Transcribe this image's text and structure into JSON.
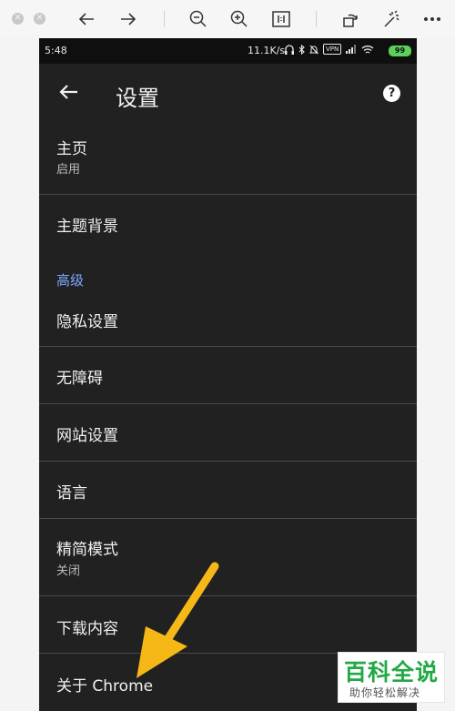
{
  "viewer": {
    "tools": [
      "close-dot",
      "minimize-dot",
      "back-arrow-icon",
      "forward-arrow-icon",
      "zoom-out-icon",
      "zoom-in-icon",
      "actual-size-icon",
      "rotate-icon",
      "magic-wand-icon",
      "more-icon"
    ]
  },
  "status_bar": {
    "time": "5:48",
    "net_speed": "11.1K/s",
    "vpn": "VPN",
    "battery": "99"
  },
  "app_bar": {
    "title": "设置",
    "help": "?"
  },
  "settings": {
    "home": {
      "label": "主页",
      "sub": "启用"
    },
    "theme": {
      "label": "主题背景"
    },
    "advanced_header": "高级",
    "privacy": {
      "label": "隐私设置"
    },
    "accessibility": {
      "label": "无障碍"
    },
    "site_settings": {
      "label": "网站设置"
    },
    "language": {
      "label": "语言"
    },
    "lite_mode": {
      "label": "精简模式",
      "sub": "关闭"
    },
    "downloads": {
      "label": "下载内容"
    },
    "about": {
      "label": "关于 Chrome"
    }
  },
  "watermark": {
    "title": "百科全说",
    "subtitle": "助你轻松解决"
  },
  "colors": {
    "phone_bg": "#212121",
    "accent_blue": "#7aa7ff",
    "arrow_yellow": "#f6b817",
    "watermark_green": "#22a845"
  }
}
